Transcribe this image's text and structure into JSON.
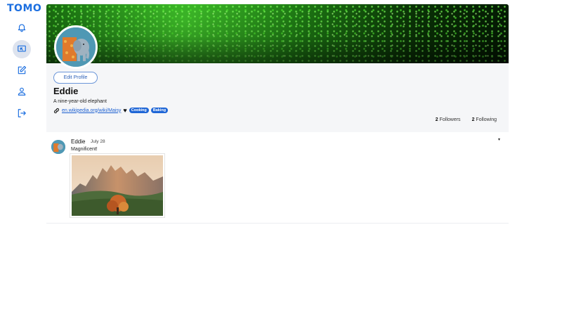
{
  "app": {
    "logo_text": "TOMO"
  },
  "sidebar": {
    "items": [
      {
        "icon": "bell-icon",
        "label": "Notifications",
        "active": false
      },
      {
        "icon": "cast-icon",
        "label": "Feed",
        "active": true
      },
      {
        "icon": "edit-icon",
        "label": "Compose",
        "active": false
      },
      {
        "icon": "user-icon",
        "label": "Profile",
        "active": false
      },
      {
        "icon": "logout-icon",
        "label": "Log out",
        "active": false
      }
    ]
  },
  "profile": {
    "edit_label": "Edit Profile",
    "name": "Eddie",
    "bio": "A nine-year-old elephant",
    "link": "en.wikipedia.org/wiki/Maisy",
    "heart": "♥",
    "tags": [
      "Cooking",
      "Baking"
    ],
    "followers_count": "2",
    "followers_label": "Followers",
    "following_count": "2",
    "following_label": "Following"
  },
  "post": {
    "author": "Eddie",
    "date": "July 28",
    "text": "Magnificent!",
    "menu_icon": "▾"
  },
  "colors": {
    "accent": "#1c6fe0",
    "tag_bg": "#1f66d6",
    "active_nav_bg": "#dde3ee"
  }
}
